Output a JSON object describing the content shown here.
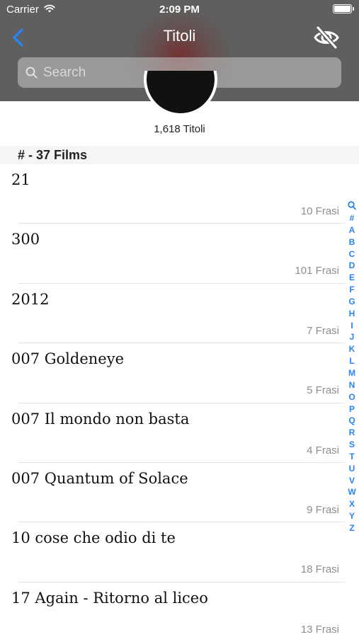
{
  "status_bar": {
    "carrier": "Carrier",
    "time": "2:09 PM"
  },
  "nav": {
    "title": "Titoli"
  },
  "search": {
    "placeholder": "Search"
  },
  "count_label": "1,618 Titoli",
  "section": {
    "header": "# - 37 Films"
  },
  "rows": [
    {
      "title": "21",
      "count": "10 Frasi"
    },
    {
      "title": "300",
      "count": "101 Frasi"
    },
    {
      "title": "2012",
      "count": "7 Frasi"
    },
    {
      "title": "007 Goldeneye",
      "count": "5 Frasi"
    },
    {
      "title": "007 Il mondo non basta",
      "count": "4 Frasi"
    },
    {
      "title": "007 Quantum of Solace",
      "count": "9 Frasi"
    },
    {
      "title": "10 cose che odio di te",
      "count": "18 Frasi"
    },
    {
      "title": "17 Again - Ritorno al liceo",
      "count": "13 Frasi"
    }
  ],
  "index_letters": [
    "#",
    "A",
    "B",
    "C",
    "D",
    "E",
    "F",
    "G",
    "H",
    "I",
    "J",
    "K",
    "L",
    "M",
    "N",
    "O",
    "P",
    "Q",
    "R",
    "S",
    "T",
    "U",
    "V",
    "W",
    "X",
    "Y",
    "Z"
  ],
  "colors": {
    "accent": "#2a83f0",
    "header_bg": "#5f5f5f"
  },
  "icons": {
    "back": "chevron-left-icon",
    "hide": "eye-slash-icon",
    "search": "search-icon"
  }
}
